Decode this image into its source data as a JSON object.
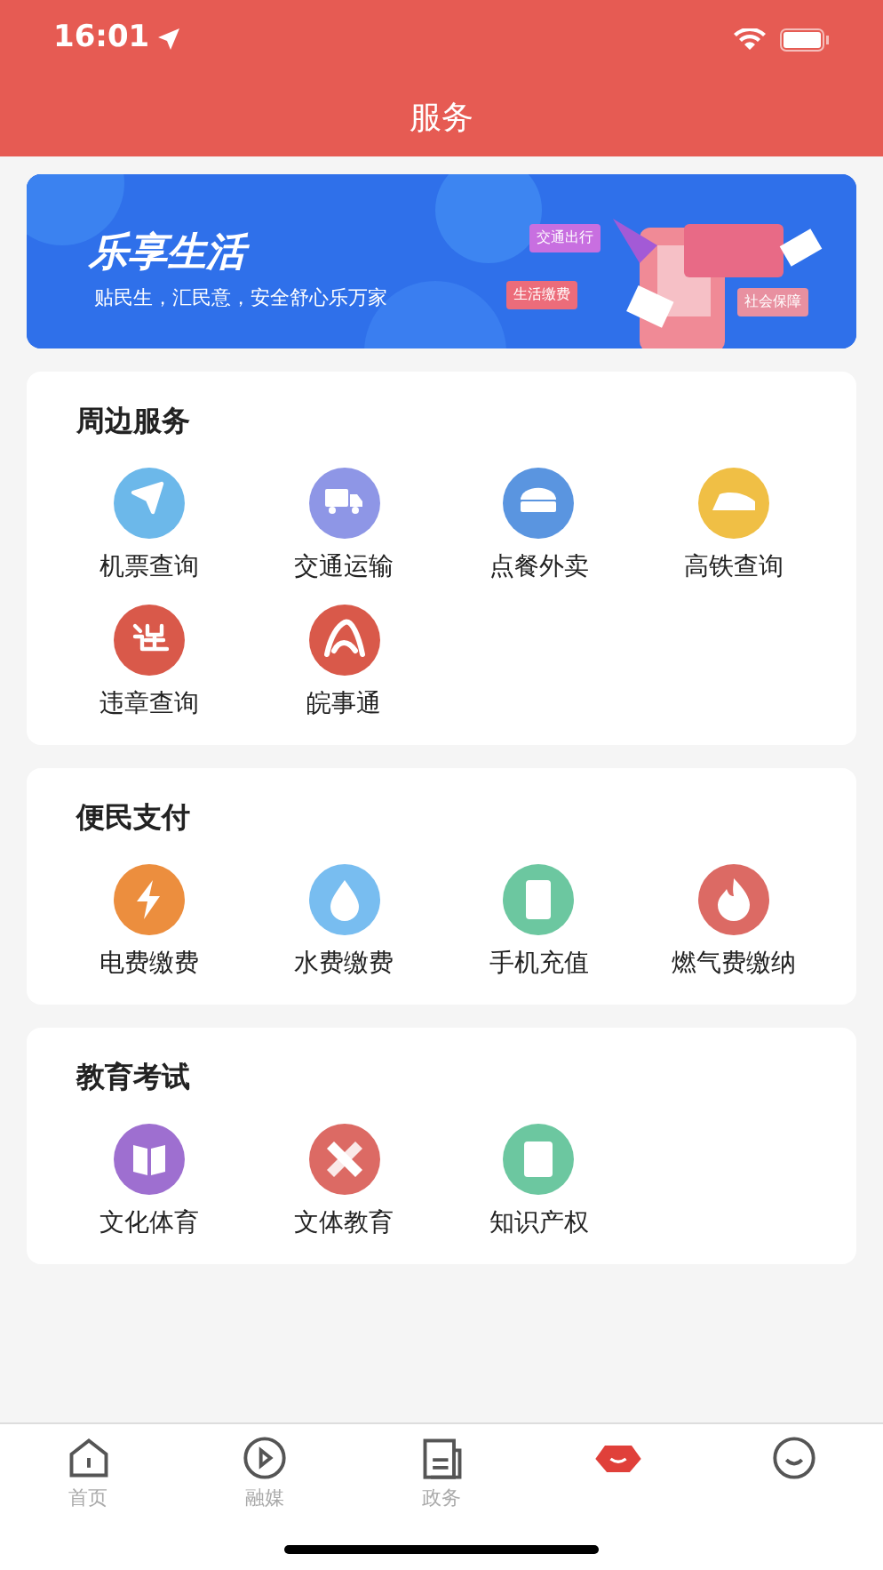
{
  "status_bar": {
    "time": "16:01"
  },
  "header": {
    "title": "服务"
  },
  "banner": {
    "title": "乐享生活",
    "subtitle": "贴民生，汇民意，安全舒心乐万家",
    "tags": [
      "交通出行",
      "生活缴费",
      "社会保障"
    ]
  },
  "sections": [
    {
      "title": "周边服务",
      "items": [
        {
          "label": "机票查询",
          "color": "#6cb8ea"
        },
        {
          "label": "交通运输",
          "color": "#8e96e6"
        },
        {
          "label": "点餐外卖",
          "color": "#5a95e0"
        },
        {
          "label": "高铁查询",
          "color": "#f0bf45"
        },
        {
          "label": "违章查询",
          "color": "#d9594a"
        },
        {
          "label": "皖事通",
          "color": "#d9594a"
        }
      ]
    },
    {
      "title": "便民支付",
      "items": [
        {
          "label": "电费缴费",
          "color": "#ec8e3e"
        },
        {
          "label": "水费缴费",
          "color": "#78bdf0"
        },
        {
          "label": "手机充值",
          "color": "#6cc7a0"
        },
        {
          "label": "燃气费缴纳",
          "color": "#dc6a64"
        }
      ]
    },
    {
      "title": "教育考试",
      "items": [
        {
          "label": "文化体育",
          "color": "#9e6fd0"
        },
        {
          "label": "文体教育",
          "color": "#dc6a64"
        },
        {
          "label": "知识产权",
          "color": "#6cc7a0"
        }
      ]
    }
  ],
  "tab_bar": [
    {
      "label": "首页",
      "selected": false
    },
    {
      "label": "融媒",
      "selected": false
    },
    {
      "label": "政务",
      "selected": false
    },
    {
      "selected": true
    },
    {
      "selected": false
    }
  ]
}
